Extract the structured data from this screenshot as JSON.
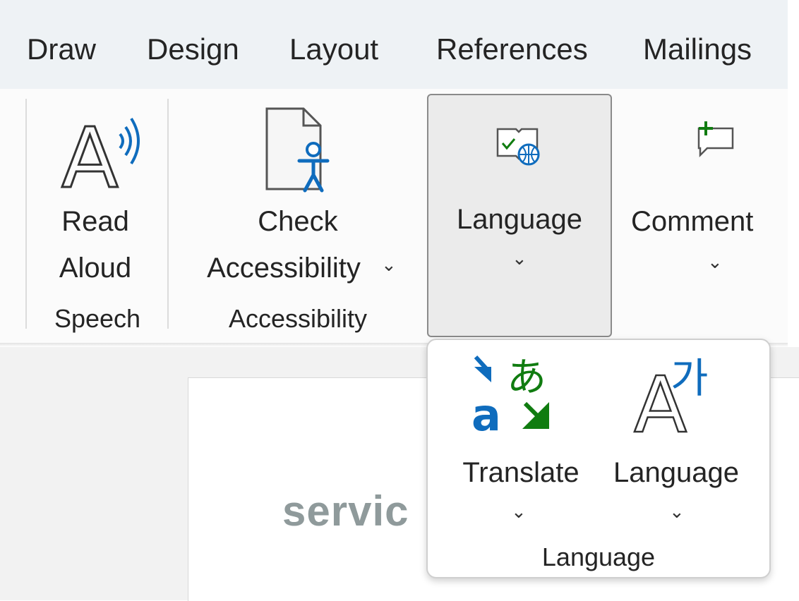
{
  "tabs": [
    "Draw",
    "Design",
    "Layout",
    "References",
    "Mailings"
  ],
  "ribbon": {
    "speech": {
      "read_aloud_line1": "Read",
      "read_aloud_line2": "Aloud",
      "group_label": "Speech",
      "icon": "read-aloud-icon"
    },
    "accessibility": {
      "check_line1": "Check",
      "check_line2": "Accessibility",
      "chevron": "⌄",
      "group_label": "Accessibility",
      "icon": "check-accessibility-icon"
    },
    "language": {
      "label": "Language",
      "chevron": "⌄",
      "icon": "language-book-globe-icon"
    },
    "comments": {
      "label": "Comment",
      "chevron": "⌄",
      "icon": "new-comment-icon"
    }
  },
  "dropdown": {
    "translate_label": "Translate",
    "translate_chevron": "⌄",
    "language_label": "Language",
    "language_chevron": "⌄",
    "group_label": "Language",
    "translate_icon": "translate-icon",
    "language_icon": "language-a-ga-icon",
    "korean_glyph": "가",
    "japanese_glyph": "あ",
    "latin_glyph_a": "a",
    "latin_glyph_big_a": "A"
  },
  "document": {
    "visible_text": "servic"
  },
  "colors": {
    "blue": "#0f6cbd",
    "green": "#107c10",
    "tab_bg": "#eef2f5"
  }
}
